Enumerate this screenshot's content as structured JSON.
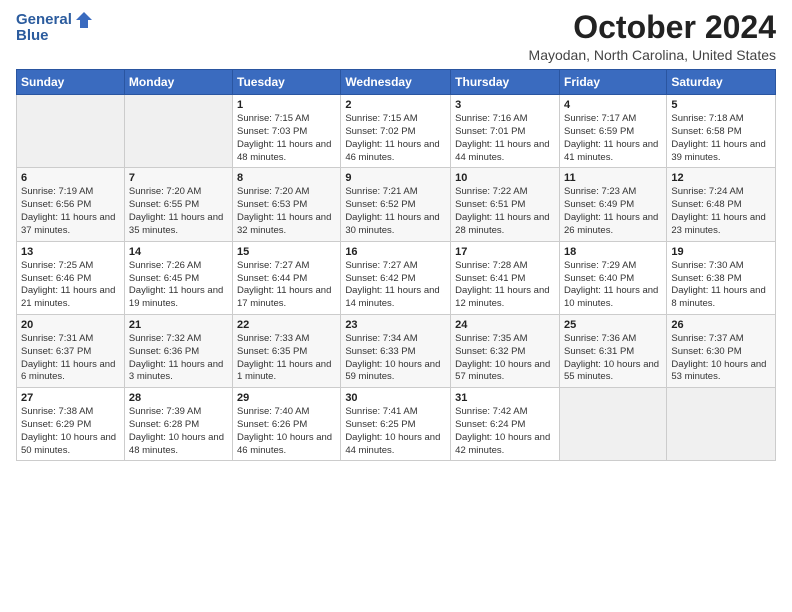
{
  "header": {
    "logo_general": "General",
    "logo_blue": "Blue",
    "month_title": "October 2024",
    "location": "Mayodan, North Carolina, United States"
  },
  "days_of_week": [
    "Sunday",
    "Monday",
    "Tuesday",
    "Wednesday",
    "Thursday",
    "Friday",
    "Saturday"
  ],
  "weeks": [
    [
      {
        "day": "",
        "info": ""
      },
      {
        "day": "",
        "info": ""
      },
      {
        "day": "1",
        "info": "Sunrise: 7:15 AM\nSunset: 7:03 PM\nDaylight: 11 hours and 48 minutes."
      },
      {
        "day": "2",
        "info": "Sunrise: 7:15 AM\nSunset: 7:02 PM\nDaylight: 11 hours and 46 minutes."
      },
      {
        "day": "3",
        "info": "Sunrise: 7:16 AM\nSunset: 7:01 PM\nDaylight: 11 hours and 44 minutes."
      },
      {
        "day": "4",
        "info": "Sunrise: 7:17 AM\nSunset: 6:59 PM\nDaylight: 11 hours and 41 minutes."
      },
      {
        "day": "5",
        "info": "Sunrise: 7:18 AM\nSunset: 6:58 PM\nDaylight: 11 hours and 39 minutes."
      }
    ],
    [
      {
        "day": "6",
        "info": "Sunrise: 7:19 AM\nSunset: 6:56 PM\nDaylight: 11 hours and 37 minutes."
      },
      {
        "day": "7",
        "info": "Sunrise: 7:20 AM\nSunset: 6:55 PM\nDaylight: 11 hours and 35 minutes."
      },
      {
        "day": "8",
        "info": "Sunrise: 7:20 AM\nSunset: 6:53 PM\nDaylight: 11 hours and 32 minutes."
      },
      {
        "day": "9",
        "info": "Sunrise: 7:21 AM\nSunset: 6:52 PM\nDaylight: 11 hours and 30 minutes."
      },
      {
        "day": "10",
        "info": "Sunrise: 7:22 AM\nSunset: 6:51 PM\nDaylight: 11 hours and 28 minutes."
      },
      {
        "day": "11",
        "info": "Sunrise: 7:23 AM\nSunset: 6:49 PM\nDaylight: 11 hours and 26 minutes."
      },
      {
        "day": "12",
        "info": "Sunrise: 7:24 AM\nSunset: 6:48 PM\nDaylight: 11 hours and 23 minutes."
      }
    ],
    [
      {
        "day": "13",
        "info": "Sunrise: 7:25 AM\nSunset: 6:46 PM\nDaylight: 11 hours and 21 minutes."
      },
      {
        "day": "14",
        "info": "Sunrise: 7:26 AM\nSunset: 6:45 PM\nDaylight: 11 hours and 19 minutes."
      },
      {
        "day": "15",
        "info": "Sunrise: 7:27 AM\nSunset: 6:44 PM\nDaylight: 11 hours and 17 minutes."
      },
      {
        "day": "16",
        "info": "Sunrise: 7:27 AM\nSunset: 6:42 PM\nDaylight: 11 hours and 14 minutes."
      },
      {
        "day": "17",
        "info": "Sunrise: 7:28 AM\nSunset: 6:41 PM\nDaylight: 11 hours and 12 minutes."
      },
      {
        "day": "18",
        "info": "Sunrise: 7:29 AM\nSunset: 6:40 PM\nDaylight: 11 hours and 10 minutes."
      },
      {
        "day": "19",
        "info": "Sunrise: 7:30 AM\nSunset: 6:38 PM\nDaylight: 11 hours and 8 minutes."
      }
    ],
    [
      {
        "day": "20",
        "info": "Sunrise: 7:31 AM\nSunset: 6:37 PM\nDaylight: 11 hours and 6 minutes."
      },
      {
        "day": "21",
        "info": "Sunrise: 7:32 AM\nSunset: 6:36 PM\nDaylight: 11 hours and 3 minutes."
      },
      {
        "day": "22",
        "info": "Sunrise: 7:33 AM\nSunset: 6:35 PM\nDaylight: 11 hours and 1 minute."
      },
      {
        "day": "23",
        "info": "Sunrise: 7:34 AM\nSunset: 6:33 PM\nDaylight: 10 hours and 59 minutes."
      },
      {
        "day": "24",
        "info": "Sunrise: 7:35 AM\nSunset: 6:32 PM\nDaylight: 10 hours and 57 minutes."
      },
      {
        "day": "25",
        "info": "Sunrise: 7:36 AM\nSunset: 6:31 PM\nDaylight: 10 hours and 55 minutes."
      },
      {
        "day": "26",
        "info": "Sunrise: 7:37 AM\nSunset: 6:30 PM\nDaylight: 10 hours and 53 minutes."
      }
    ],
    [
      {
        "day": "27",
        "info": "Sunrise: 7:38 AM\nSunset: 6:29 PM\nDaylight: 10 hours and 50 minutes."
      },
      {
        "day": "28",
        "info": "Sunrise: 7:39 AM\nSunset: 6:28 PM\nDaylight: 10 hours and 48 minutes."
      },
      {
        "day": "29",
        "info": "Sunrise: 7:40 AM\nSunset: 6:26 PM\nDaylight: 10 hours and 46 minutes."
      },
      {
        "day": "30",
        "info": "Sunrise: 7:41 AM\nSunset: 6:25 PM\nDaylight: 10 hours and 44 minutes."
      },
      {
        "day": "31",
        "info": "Sunrise: 7:42 AM\nSunset: 6:24 PM\nDaylight: 10 hours and 42 minutes."
      },
      {
        "day": "",
        "info": ""
      },
      {
        "day": "",
        "info": ""
      }
    ]
  ]
}
